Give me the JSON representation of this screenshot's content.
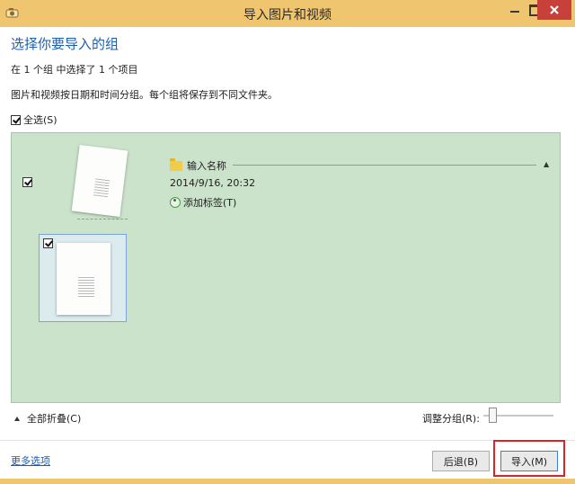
{
  "window": {
    "title": "导入图片和视频",
    "accent_color": "#efc56f",
    "close_color": "#c7403a"
  },
  "header": {
    "heading": "选择你要导入的组",
    "summary": "在 1 个组 中选择了 1 个项目",
    "description": "图片和视频按日期和时间分组。每个组将保存到不同文件夹。"
  },
  "select_all": {
    "label": "全选(S)",
    "checked": true
  },
  "group": {
    "checked": true,
    "name": "输入名称",
    "date": "2014/9/16, 20:32",
    "add_tag_label": "添加标签(T)",
    "panel_color": "#cae3ca",
    "items": [
      {
        "checked": true
      }
    ]
  },
  "controls": {
    "collapse_all_label": "全部折叠(C)",
    "adjust_groups_label": "调整分组(R):"
  },
  "footer": {
    "more_options_label": "更多选项",
    "back_label": "后退(B)",
    "import_label": "导入(M)",
    "highlight_color": "#d9252a"
  }
}
